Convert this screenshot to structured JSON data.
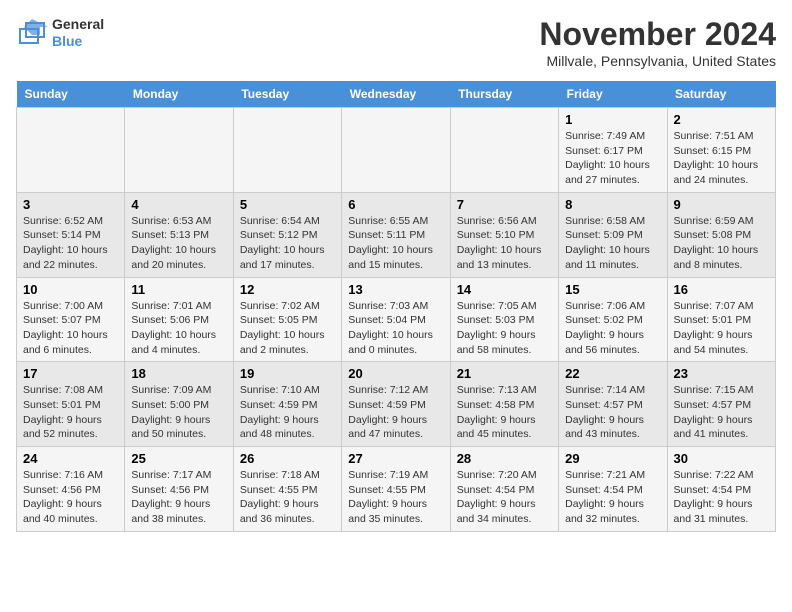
{
  "header": {
    "logo_line1": "General",
    "logo_line2": "Blue",
    "month_title": "November 2024",
    "location": "Millvale, Pennsylvania, United States"
  },
  "weekdays": [
    "Sunday",
    "Monday",
    "Tuesday",
    "Wednesday",
    "Thursday",
    "Friday",
    "Saturday"
  ],
  "weeks": [
    [
      {
        "day": "",
        "info": ""
      },
      {
        "day": "",
        "info": ""
      },
      {
        "day": "",
        "info": ""
      },
      {
        "day": "",
        "info": ""
      },
      {
        "day": "",
        "info": ""
      },
      {
        "day": "1",
        "info": "Sunrise: 7:49 AM\nSunset: 6:17 PM\nDaylight: 10 hours and 27 minutes."
      },
      {
        "day": "2",
        "info": "Sunrise: 7:51 AM\nSunset: 6:15 PM\nDaylight: 10 hours and 24 minutes."
      }
    ],
    [
      {
        "day": "3",
        "info": "Sunrise: 6:52 AM\nSunset: 5:14 PM\nDaylight: 10 hours and 22 minutes."
      },
      {
        "day": "4",
        "info": "Sunrise: 6:53 AM\nSunset: 5:13 PM\nDaylight: 10 hours and 20 minutes."
      },
      {
        "day": "5",
        "info": "Sunrise: 6:54 AM\nSunset: 5:12 PM\nDaylight: 10 hours and 17 minutes."
      },
      {
        "day": "6",
        "info": "Sunrise: 6:55 AM\nSunset: 5:11 PM\nDaylight: 10 hours and 15 minutes."
      },
      {
        "day": "7",
        "info": "Sunrise: 6:56 AM\nSunset: 5:10 PM\nDaylight: 10 hours and 13 minutes."
      },
      {
        "day": "8",
        "info": "Sunrise: 6:58 AM\nSunset: 5:09 PM\nDaylight: 10 hours and 11 minutes."
      },
      {
        "day": "9",
        "info": "Sunrise: 6:59 AM\nSunset: 5:08 PM\nDaylight: 10 hours and 8 minutes."
      }
    ],
    [
      {
        "day": "10",
        "info": "Sunrise: 7:00 AM\nSunset: 5:07 PM\nDaylight: 10 hours and 6 minutes."
      },
      {
        "day": "11",
        "info": "Sunrise: 7:01 AM\nSunset: 5:06 PM\nDaylight: 10 hours and 4 minutes."
      },
      {
        "day": "12",
        "info": "Sunrise: 7:02 AM\nSunset: 5:05 PM\nDaylight: 10 hours and 2 minutes."
      },
      {
        "day": "13",
        "info": "Sunrise: 7:03 AM\nSunset: 5:04 PM\nDaylight: 10 hours and 0 minutes."
      },
      {
        "day": "14",
        "info": "Sunrise: 7:05 AM\nSunset: 5:03 PM\nDaylight: 9 hours and 58 minutes."
      },
      {
        "day": "15",
        "info": "Sunrise: 7:06 AM\nSunset: 5:02 PM\nDaylight: 9 hours and 56 minutes."
      },
      {
        "day": "16",
        "info": "Sunrise: 7:07 AM\nSunset: 5:01 PM\nDaylight: 9 hours and 54 minutes."
      }
    ],
    [
      {
        "day": "17",
        "info": "Sunrise: 7:08 AM\nSunset: 5:01 PM\nDaylight: 9 hours and 52 minutes."
      },
      {
        "day": "18",
        "info": "Sunrise: 7:09 AM\nSunset: 5:00 PM\nDaylight: 9 hours and 50 minutes."
      },
      {
        "day": "19",
        "info": "Sunrise: 7:10 AM\nSunset: 4:59 PM\nDaylight: 9 hours and 48 minutes."
      },
      {
        "day": "20",
        "info": "Sunrise: 7:12 AM\nSunset: 4:59 PM\nDaylight: 9 hours and 47 minutes."
      },
      {
        "day": "21",
        "info": "Sunrise: 7:13 AM\nSunset: 4:58 PM\nDaylight: 9 hours and 45 minutes."
      },
      {
        "day": "22",
        "info": "Sunrise: 7:14 AM\nSunset: 4:57 PM\nDaylight: 9 hours and 43 minutes."
      },
      {
        "day": "23",
        "info": "Sunrise: 7:15 AM\nSunset: 4:57 PM\nDaylight: 9 hours and 41 minutes."
      }
    ],
    [
      {
        "day": "24",
        "info": "Sunrise: 7:16 AM\nSunset: 4:56 PM\nDaylight: 9 hours and 40 minutes."
      },
      {
        "day": "25",
        "info": "Sunrise: 7:17 AM\nSunset: 4:56 PM\nDaylight: 9 hours and 38 minutes."
      },
      {
        "day": "26",
        "info": "Sunrise: 7:18 AM\nSunset: 4:55 PM\nDaylight: 9 hours and 36 minutes."
      },
      {
        "day": "27",
        "info": "Sunrise: 7:19 AM\nSunset: 4:55 PM\nDaylight: 9 hours and 35 minutes."
      },
      {
        "day": "28",
        "info": "Sunrise: 7:20 AM\nSunset: 4:54 PM\nDaylight: 9 hours and 34 minutes."
      },
      {
        "day": "29",
        "info": "Sunrise: 7:21 AM\nSunset: 4:54 PM\nDaylight: 9 hours and 32 minutes."
      },
      {
        "day": "30",
        "info": "Sunrise: 7:22 AM\nSunset: 4:54 PM\nDaylight: 9 hours and 31 minutes."
      }
    ]
  ]
}
